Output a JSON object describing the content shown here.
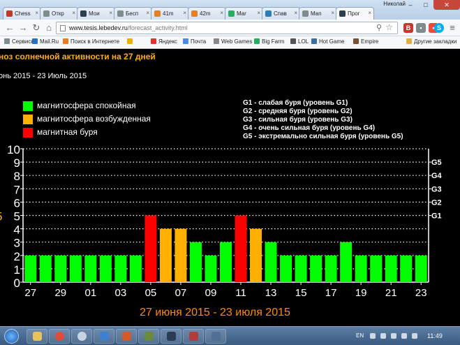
{
  "browser": {
    "user_name": "Николай",
    "tabs": [
      {
        "label": "Chess",
        "color": "#c0392b"
      },
      {
        "label": "Откр",
        "color": "#7f8c8d"
      },
      {
        "label": "Мои",
        "color": "#2c3e50"
      },
      {
        "label": "Бесп",
        "color": "#7f8c8d"
      },
      {
        "label": "41m",
        "color": "#e67e22"
      },
      {
        "label": "42m",
        "color": "#e67e22"
      },
      {
        "label": "Mar",
        "color": "#27ae60"
      },
      {
        "label": "Спав",
        "color": "#2980b9"
      },
      {
        "label": "Man",
        "color": "#7f8c8d"
      },
      {
        "label": "Прог",
        "color": "#2c3e50"
      }
    ],
    "url_host": "www.tesis.lebedev.ru",
    "url_path": "/forecast_activity.html",
    "bookmarks": [
      "Сервисы",
      "Mail.Ru",
      "Поиск в Интернете",
      "",
      "Яндекс",
      "Почта",
      "Web Games",
      "Big Farm",
      "LOL",
      "Hot Game",
      "Empire"
    ],
    "other_bookmarks": "Другие закладки"
  },
  "page": {
    "title": "ноз солнечной активности на 27 дней",
    "dates": "онь 2015 - 23 Июль 2015",
    "legend": [
      {
        "label": "магнитосфера спокойная",
        "color": "#00ff00"
      },
      {
        "label": "магнитосфера возбужденная",
        "color": "#ffb000"
      },
      {
        "label": "магнитная буря",
        "color": "#ff0000"
      }
    ],
    "storm_levels": [
      "G1 - слабая буря (уровень G1)",
      "G2 - средняя буря (уровень G2)",
      "G3 - сильная буря (уровень G3)",
      "G4 - очень сильная буря (уровень G4)",
      "G5 - экстремально сильная буря (уровень G5)"
    ]
  },
  "chart_data": {
    "type": "bar",
    "title": "27 июня 2015 - 23 июля 2015",
    "xlabel": "",
    "ylabel": "",
    "ylim": [
      0,
      10
    ],
    "yticks": [
      0,
      1,
      2,
      3,
      4,
      5,
      6,
      7,
      8,
      9,
      10
    ],
    "right_ticks": [
      {
        "label": "G1",
        "value": 5
      },
      {
        "label": "G2",
        "value": 6
      },
      {
        "label": "G3",
        "value": 7
      },
      {
        "label": "G4",
        "value": 8
      },
      {
        "label": "G5",
        "value": 9
      }
    ],
    "x_tick_labels": [
      "27",
      "29",
      "01",
      "03",
      "05",
      "07",
      "09",
      "11",
      "13",
      "15",
      "17",
      "19",
      "21",
      "23"
    ],
    "categories": [
      "27",
      "28",
      "29",
      "30",
      "01",
      "02",
      "03",
      "04",
      "05",
      "06",
      "07",
      "08",
      "09",
      "10",
      "11",
      "12",
      "13",
      "14",
      "15",
      "16",
      "17",
      "18",
      "19",
      "20",
      "21",
      "22",
      "23"
    ],
    "values": [
      2,
      2,
      2,
      2,
      2,
      2,
      2,
      2,
      5,
      4,
      4,
      3,
      2,
      3,
      5,
      4,
      3,
      2,
      2,
      2,
      2,
      3,
      2,
      2,
      2,
      2,
      2
    ],
    "bar_colors": [
      "#00ff00",
      "#00ff00",
      "#00ff00",
      "#00ff00",
      "#00ff00",
      "#00ff00",
      "#00ff00",
      "#00ff00",
      "#ff0000",
      "#ffb000",
      "#ffb000",
      "#00ff00",
      "#00ff00",
      "#00ff00",
      "#ff0000",
      "#ffb000",
      "#00ff00",
      "#00ff00",
      "#00ff00",
      "#00ff00",
      "#00ff00",
      "#00ff00",
      "#00ff00",
      "#00ff00",
      "#00ff00",
      "#00ff00",
      "#00ff00"
    ],
    "highlight_tick": 5,
    "highlight_color": "#ffb000",
    "grid": true
  },
  "taskbar": {
    "language": "EN",
    "time": "11:49"
  }
}
